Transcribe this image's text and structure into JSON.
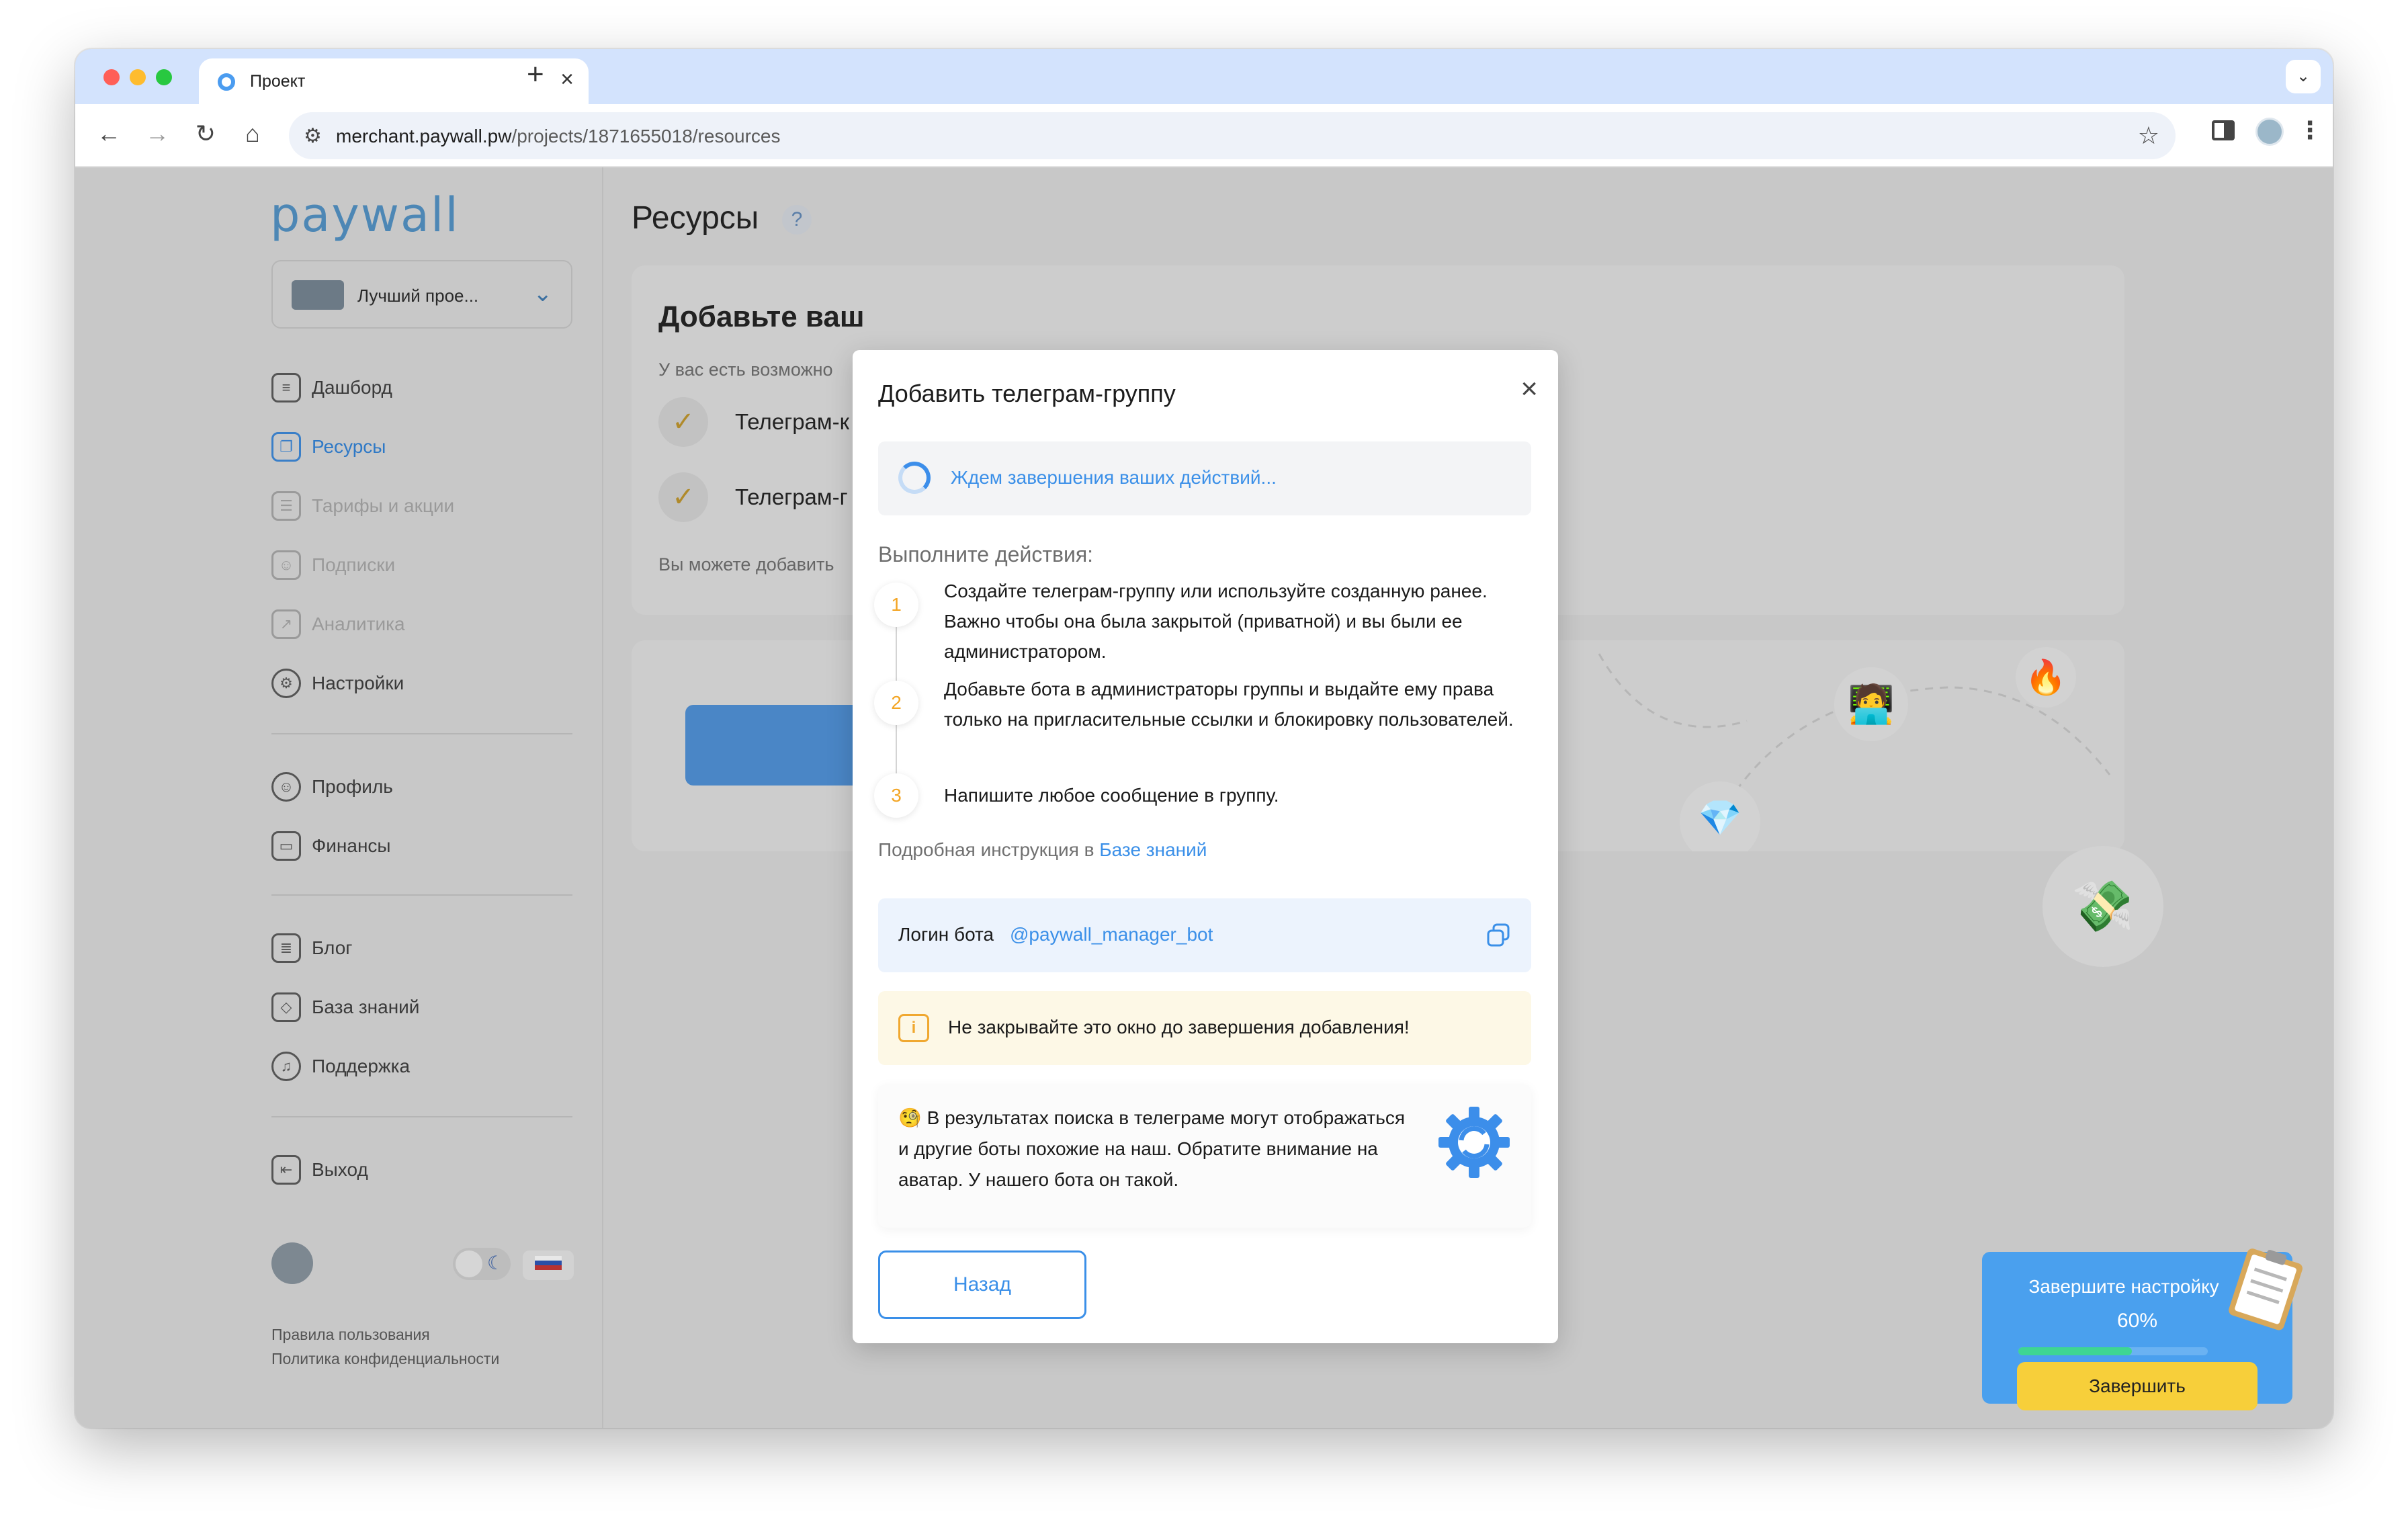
{
  "browser": {
    "tab_title": "Проект",
    "url_host": "merchant.paywall.pw",
    "url_path": "/projects/1871655018/resources"
  },
  "sidebar": {
    "logo": "paywall",
    "project_name": "Лучший прое...",
    "menu_main": [
      {
        "label": "Дашборд",
        "icon": "dashboard-icon",
        "state": "normal"
      },
      {
        "label": "Ресурсы",
        "icon": "resources-icon",
        "state": "active"
      },
      {
        "label": "Тарифы и акции",
        "icon": "tariffs-icon",
        "state": "disabled"
      },
      {
        "label": "Подписки",
        "icon": "subscriptions-icon",
        "state": "disabled"
      },
      {
        "label": "Аналитика",
        "icon": "analytics-icon",
        "state": "disabled"
      },
      {
        "label": "Настройки",
        "icon": "settings-icon",
        "state": "normal"
      }
    ],
    "menu_account": [
      {
        "label": "Профиль",
        "icon": "profile-icon"
      },
      {
        "label": "Финансы",
        "icon": "wallet-icon"
      }
    ],
    "menu_info": [
      {
        "label": "Блог",
        "icon": "blog-icon"
      },
      {
        "label": "База знаний",
        "icon": "knowledge-base-icon"
      },
      {
        "label": "Поддержка",
        "icon": "headset-icon"
      }
    ],
    "logout_label": "Выход",
    "footer": {
      "terms": "Правила пользования",
      "privacy": "Политика конфиденциальности"
    }
  },
  "main": {
    "page_title": "Ресурсы",
    "help": "?",
    "card_title": "Добавьте ваш",
    "card_subtitle": "У вас есть возможно",
    "checklist": [
      {
        "label": "Телеграм-к"
      },
      {
        "label": "Телеграм-г"
      }
    ],
    "card_footer": "Вы можете добавить"
  },
  "modal": {
    "title": "Добавить телеграм-группу",
    "waiting_text": "Ждем завершения ваших действий...",
    "steps_heading": "Выполните действия:",
    "steps": [
      {
        "number": "1",
        "text": "Создайте телеграм-группу или используйте созданную ранее. Важно чтобы она была закрытой (приватной) и вы были ее администратором."
      },
      {
        "number": "2",
        "text": "Добавьте бота в администраторы группы и выдайте ему права только на пригласительные ссылки и блокировку пользователей."
      },
      {
        "number": "3",
        "text": "Напишите любое сообщение в группу."
      }
    ],
    "guide_prefix": "Подробная инструкция в",
    "guide_link": "Базе знаний",
    "bot_login_label": "Логин бота",
    "bot_login_value": "@paywall_manager_bot",
    "warning_text": "Не закрывайте это окно до завершения добавления!",
    "note_emoji": "🧐",
    "note_text": "В результатах поиска в телеграме могут отображаться и другие боты похожие на наш. Обратите внимание на аватар. У нашего бота он такой.",
    "back_button": "Назад"
  },
  "setup_widget": {
    "title": "Завершите настройку",
    "percent_label": "60%",
    "progress": 0.6,
    "button_label": "Завершить"
  },
  "colors": {
    "accent": "#3a8fe8",
    "step_number": "#f3a524",
    "warning_bg": "#fdf8e6",
    "setup_bg": "#4aa0ee",
    "setup_button": "#f7cf3a",
    "progress_fill": "#3ed693"
  }
}
